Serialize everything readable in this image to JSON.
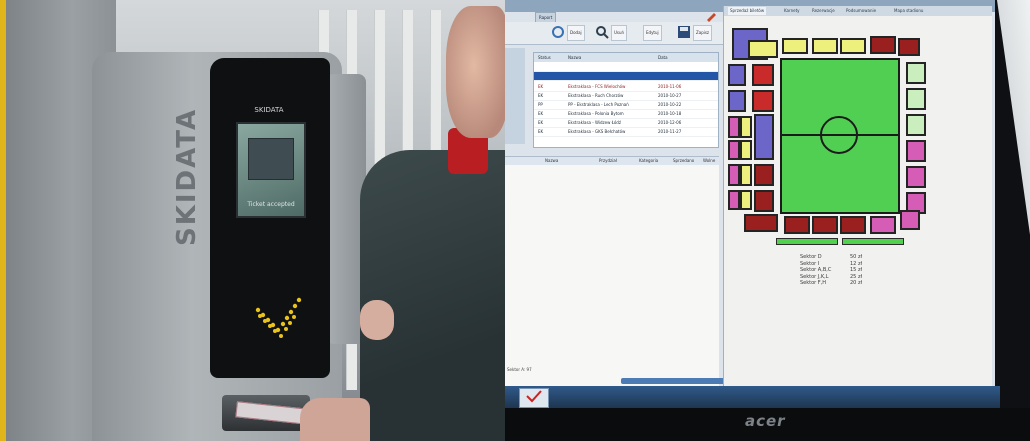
{
  "photo_left": {
    "terminal_screen_title": "SKIDATA",
    "terminal_screen_caption": "Ticket accepted",
    "vendor_vertical": "SKIDATA",
    "indicator_symbol": "✓"
  },
  "monitor": {
    "window_title": "Raport",
    "toolbar": [
      "Dodaj",
      "Usuń",
      "Edytuj",
      "Zapisz"
    ],
    "grid_headers": [
      "Status",
      "Nazwa",
      "Data"
    ],
    "grid_rows": [
      {
        "status": "",
        "name": "",
        "date": ""
      },
      {
        "status": "",
        "name": "",
        "date": ""
      },
      {
        "status": "EK",
        "name": "Ekstraklasa - FCS Wielochów",
        "date": "2010-11-06"
      },
      {
        "status": "EK",
        "name": "Ekstraklasa - Ruch Chorzów",
        "date": "2010-10-27"
      },
      {
        "status": "PP",
        "name": "PP - Ekstraklasa - Lech Poznań",
        "date": "2010-10-22"
      },
      {
        "status": "EK",
        "name": "Ekstraklasa - Polonia Bytom",
        "date": "2010-10-18"
      },
      {
        "status": "EK",
        "name": "Ekstraklasa - Widzew Łódź",
        "date": "2010-12-06"
      },
      {
        "status": "EK",
        "name": "Ekstraklasa - GKS Bełchatów",
        "date": "2010-11-27"
      }
    ],
    "lower_headers": [
      "Nazwa",
      "Przydział",
      "Kategoria",
      "Sprzedano",
      "Wolne"
    ],
    "status_line": "Sektor A: 97",
    "right_tabs": [
      "Sprzedaż biletów",
      "Karnety",
      "Rezerwacje",
      "Podsumowanie",
      "Mapa stadionu"
    ],
    "legend": [
      {
        "label": "Sektor D",
        "value": "50 zł"
      },
      {
        "label": "Sektor I",
        "value": "12 zł"
      },
      {
        "label": "Sektor A,B,C",
        "value": "15 zł"
      },
      {
        "label": "Sektor J,K,L",
        "value": "25 zł"
      },
      {
        "label": "Sektor F,H",
        "value": "20 zł"
      }
    ],
    "brand": "acer"
  },
  "colors": {
    "pitch": "#51cf52",
    "sector_yellow": "#eef07e",
    "sector_dark_red": "#9a1f1f",
    "sector_blue": "#6c66c9",
    "sector_red": "#c92b2b",
    "sector_pink": "#d65db6",
    "sector_light_green": "#cbeebf",
    "taskbar": "#305a8a"
  }
}
